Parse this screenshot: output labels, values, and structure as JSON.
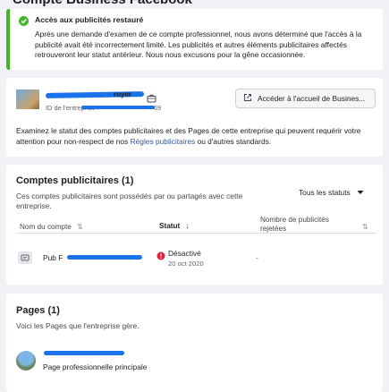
{
  "page": {
    "title": "Compte Business Facebook"
  },
  "banner": {
    "title": "Accès aux publicités restauré",
    "body": "Après une demande d'examen de ce compte professionnel, nous avons déterminé que l'accès à la publicité avait été incorrectement limité. Les publicités et autres éléments publicitaires affectés retrouveront leur statut antérieur. Nous nous excusons pour la gêne occasionnée."
  },
  "business": {
    "name_suffix": "royer",
    "id_prefix": "ID de l'entreprise :",
    "id_suffix": "69",
    "home_button": "Accéder à l'accueil de Busines...",
    "desc_before": "Examinez le statut des comptes publicitaires et des Pages de cette entreprise qui peuvent requérir votre attention pour non-respect de nos ",
    "desc_link": "Règles publicitaires",
    "desc_after": " ou d'autres standards."
  },
  "ad_accounts": {
    "title": "Comptes publicitaires (1)",
    "subtitle": "Ces comptes publicitaires sont possédés par ou partagés avec cette entreprise.",
    "filter": "Tous les statuts",
    "columns": {
      "name": "Nom du compte",
      "status": "Statut",
      "count": "Nombre de publicités rejetées"
    },
    "rows": [
      {
        "name": "Pub F",
        "status": "Désactivé",
        "date": "20 oct 2020",
        "count": "-"
      }
    ]
  },
  "pages": {
    "title": "Pages (1)",
    "subtitle": "Voici les Pages que l'entreprise gère.",
    "items": [
      {
        "type": "Page professionnelle principale"
      }
    ]
  },
  "colors": {
    "accent": "#42b72a",
    "link": "#385898",
    "redaction": "#1a73e8",
    "error": "#e41e3f"
  }
}
